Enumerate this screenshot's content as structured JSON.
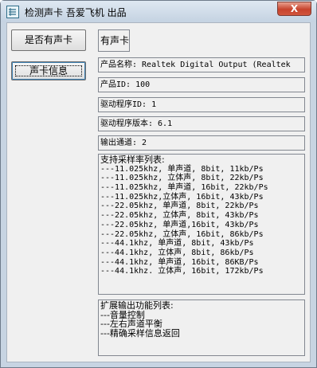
{
  "window": {
    "title": "检测声卡 吾爱飞机 出品",
    "close_label": "X"
  },
  "buttons": {
    "has_card_check": "是否有声卡",
    "card_info": "声卡信息"
  },
  "result": "有声卡",
  "fields": {
    "product_name": "产品名称: Realtek Digital Output (Realtek",
    "product_id": "产品ID: 100",
    "driver_id": "驱动程序ID: 1",
    "driver_version": "驱动程序版本: 6.1",
    "output_channels": "输出通道: 2"
  },
  "sample_rates": {
    "header": "支持采样率列表:",
    "items": [
      "---11.025khz, 单声道, 8bit, 11kb/Ps",
      "---11.025khz, 立体声, 8bit, 22kb/Ps",
      "---11.025khz, 单声道, 16bit, 22kb/Ps",
      "---11.025khz,立体声, 16bit, 43kb/Ps",
      "---22.05khz, 单声道, 8bit, 22kb/Ps",
      "---22.05khz, 立体声, 8bit, 43kb/Ps",
      "---22.05khz, 单声道,16bit, 43kb/Ps",
      "---22.05khz, 立体声, 16bit, 86kb/Ps",
      "---44.1khz, 单声道, 8bit, 43kb/Ps",
      "---44.1khz, 立体声, 8bit, 86kb/Ps",
      "---44.1khz, 单声道, 16bit, 86KB/Ps",
      "---44.1khz. 立体声, 16bit, 172kb/Ps"
    ]
  },
  "extended_functions": {
    "header": "扩展输出功能列表:",
    "items": [
      "---音量控制",
      "---左右声道平衡",
      "---精确采样信息返回"
    ]
  },
  "colors": {
    "title_gradient_top": "#dfe8f2",
    "close_button": "#c7432d",
    "client_bg": "#f0f0f0"
  }
}
